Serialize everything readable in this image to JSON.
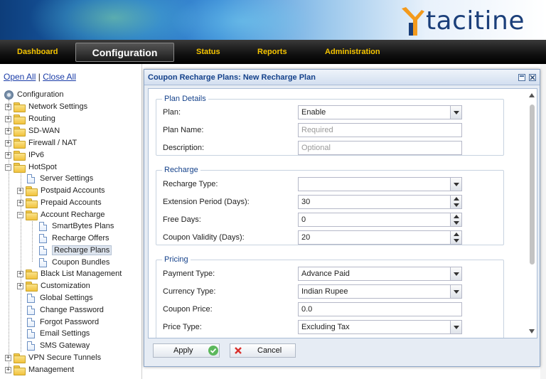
{
  "header": {
    "brand": "tacitine"
  },
  "nav": {
    "dashboard": "Dashboard",
    "configuration": "Configuration",
    "status": "Status",
    "reports": "Reports",
    "administration": "Administration"
  },
  "sidebar": {
    "open_all": "Open All",
    "separator": "|",
    "close_all": "Close All",
    "root": "Configuration",
    "items": {
      "network_settings": "Network Settings",
      "routing": "Routing",
      "sdwan": "SD-WAN",
      "firewall": "Firewall / NAT",
      "ipv6": "IPv6",
      "hotspot": "HotSpot",
      "server_settings": "Server Settings",
      "postpaid": "Postpaid Accounts",
      "prepaid": "Prepaid Accounts",
      "account_recharge": "Account Recharge",
      "smartbytes": "SmartBytes Plans",
      "recharge_offers": "Recharge Offers",
      "recharge_plans": "Recharge Plans",
      "coupon_bundles": "Coupon Bundles",
      "blacklist": "Black List Management",
      "customization": "Customization",
      "global_settings": "Global Settings",
      "change_password": "Change Password",
      "forgot_password": "Forgot Password",
      "email_settings": "Email Settings",
      "sms_gateway": "SMS Gateway",
      "vpn": "VPN Secure Tunnels",
      "management": "Management"
    }
  },
  "dialog": {
    "title": "Coupon Recharge Plans: New Recharge Plan",
    "plan_details": {
      "legend": "Plan Details",
      "plan_label": "Plan:",
      "plan_value": "Enable",
      "name_label": "Plan Name:",
      "name_placeholder": "Required",
      "desc_label": "Description:",
      "desc_placeholder": "Optional"
    },
    "recharge": {
      "legend": "Recharge",
      "type_label": "Recharge Type:",
      "type_value": "",
      "ext_label": "Extension Period (Days):",
      "ext_value": "30",
      "free_label": "Free Days:",
      "free_value": "0",
      "validity_label": "Coupon Validity (Days):",
      "validity_value": "20"
    },
    "pricing": {
      "legend": "Pricing",
      "payment_label": "Payment Type:",
      "payment_value": "Advance Paid",
      "currency_label": "Currency Type:",
      "currency_value": "Indian Rupee",
      "price_label": "Coupon Price:",
      "price_value": "0.0",
      "pricetype_label": "Price Type:",
      "pricetype_value": "Excluding Tax"
    },
    "apply": "Apply",
    "cancel": "Cancel"
  }
}
